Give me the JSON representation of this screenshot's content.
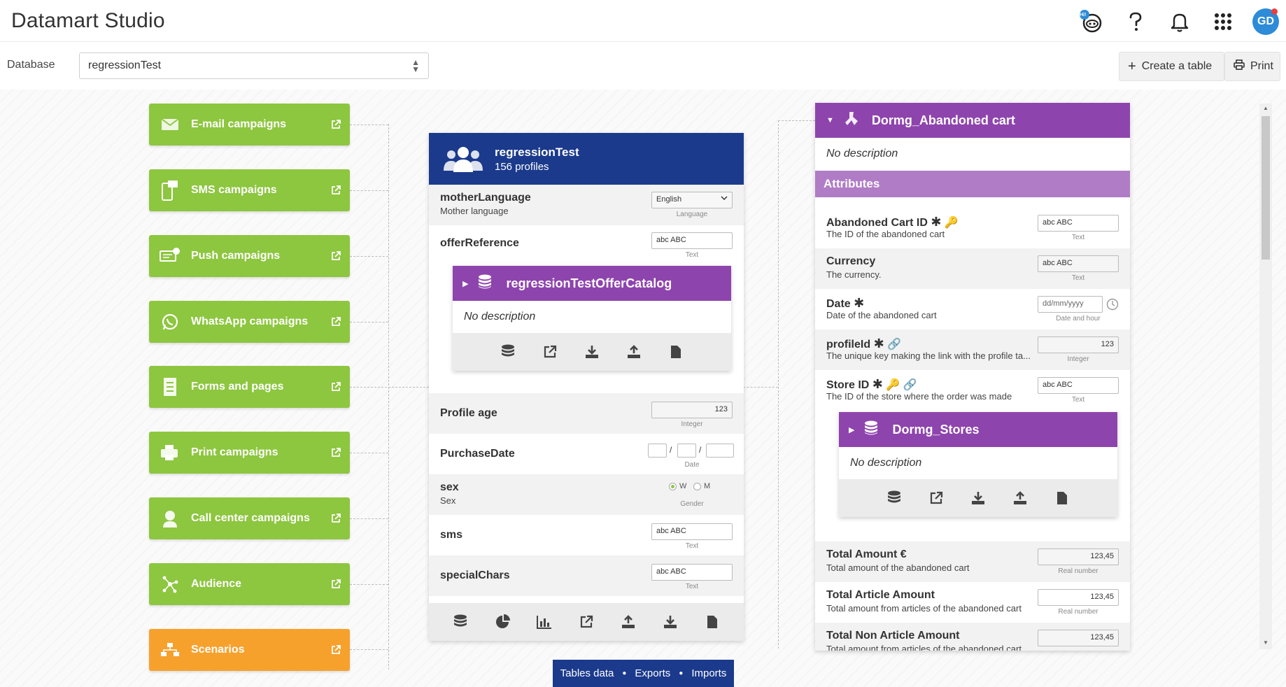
{
  "app": {
    "title": "Datamart Studio"
  },
  "topbar": {
    "avatar_initials": "GD",
    "hi_badge": "Hi!"
  },
  "database": {
    "label": "Database",
    "value": "regressionTest"
  },
  "actions": {
    "create_table": "Create a table",
    "print": "Print"
  },
  "campaigns": [
    {
      "label": "E-mail campaigns",
      "icon": "email-icon",
      "color": "#8dc63f"
    },
    {
      "label": "SMS campaigns",
      "icon": "sms-icon",
      "color": "#8dc63f"
    },
    {
      "label": "Push campaigns",
      "icon": "push-icon",
      "color": "#8dc63f"
    },
    {
      "label": "WhatsApp campaigns",
      "icon": "whatsapp-icon",
      "color": "#8dc63f"
    },
    {
      "label": "Forms and pages",
      "icon": "forms-icon",
      "color": "#8dc63f"
    },
    {
      "label": "Print campaigns",
      "icon": "print-campaign-icon",
      "color": "#8dc63f"
    },
    {
      "label": "Call center campaigns",
      "icon": "headset-icon",
      "color": "#8dc63f"
    },
    {
      "label": "Audience",
      "icon": "audience-icon",
      "color": "#8dc63f"
    },
    {
      "label": "Scenarios",
      "icon": "scenarios-icon",
      "color": "#f7a12d"
    }
  ],
  "main_table": {
    "name": "regressionTest",
    "profiles": "156 profiles",
    "fields": {
      "motherLanguage": {
        "name": "motherLanguage",
        "desc": "Mother language",
        "value": "English",
        "type": "Language"
      },
      "offerReference": {
        "name": "offerReference",
        "value": "abc ABC",
        "type": "Text"
      },
      "profileAge": {
        "name": "Profile age",
        "value": "123",
        "type": "Integer"
      },
      "purchaseDate": {
        "name": "PurchaseDate",
        "sep": "/",
        "type": "Date"
      },
      "sex": {
        "name": "sex",
        "desc": "Sex",
        "opt_w": "W",
        "opt_m": "M",
        "type": "Gender"
      },
      "sms": {
        "name": "sms",
        "value": "abc ABC",
        "type": "Text"
      },
      "specialChars": {
        "name": "specialChars",
        "value": "abc ABC",
        "type": "Text"
      }
    },
    "offer_catalog": {
      "name": "regressionTestOfferCatalog",
      "desc": "No description"
    }
  },
  "cart_table": {
    "name": "Dormg_Abandoned cart",
    "desc": "No description",
    "section": "Attributes",
    "fields": {
      "cartId": {
        "name": "Abandoned Cart ID",
        "desc": "The ID of the abandoned cart",
        "value": "abc ABC",
        "type": "Text"
      },
      "currency": {
        "name": "Currency",
        "desc": "The currency.",
        "value": "abc ABC",
        "type": "Text"
      },
      "date": {
        "name": "Date",
        "desc": "Date of the abandoned cart",
        "value": "dd/mm/yyyy",
        "type": "Date and hour"
      },
      "profileId": {
        "name": "profileId",
        "desc": "The unique key making the link with the profile ta...",
        "value": "123",
        "type": "Integer"
      },
      "storeId": {
        "name": "Store ID",
        "desc": "The ID of the store where the order was made",
        "value": "abc ABC",
        "type": "Text"
      },
      "totalAmount": {
        "name": "Total Amount",
        "unit": "€",
        "desc": "Total amount of the abandoned cart",
        "value": "123,45",
        "type": "Real number"
      },
      "totalArticle": {
        "name": "Total Article Amount",
        "desc": "Total amount from articles of the abandoned cart",
        "value": "123,45",
        "type": "Real number"
      },
      "totalNonArticle": {
        "name": "Total Non Article Amount",
        "desc": "Total amount from articles of the abandoned cart",
        "value": "123,45"
      }
    },
    "stores": {
      "name": "Dormg_Stores",
      "desc": "No description"
    }
  },
  "bottom_tabs": {
    "tables_data": "Tables data",
    "exports": "Exports",
    "imports": "Imports"
  }
}
